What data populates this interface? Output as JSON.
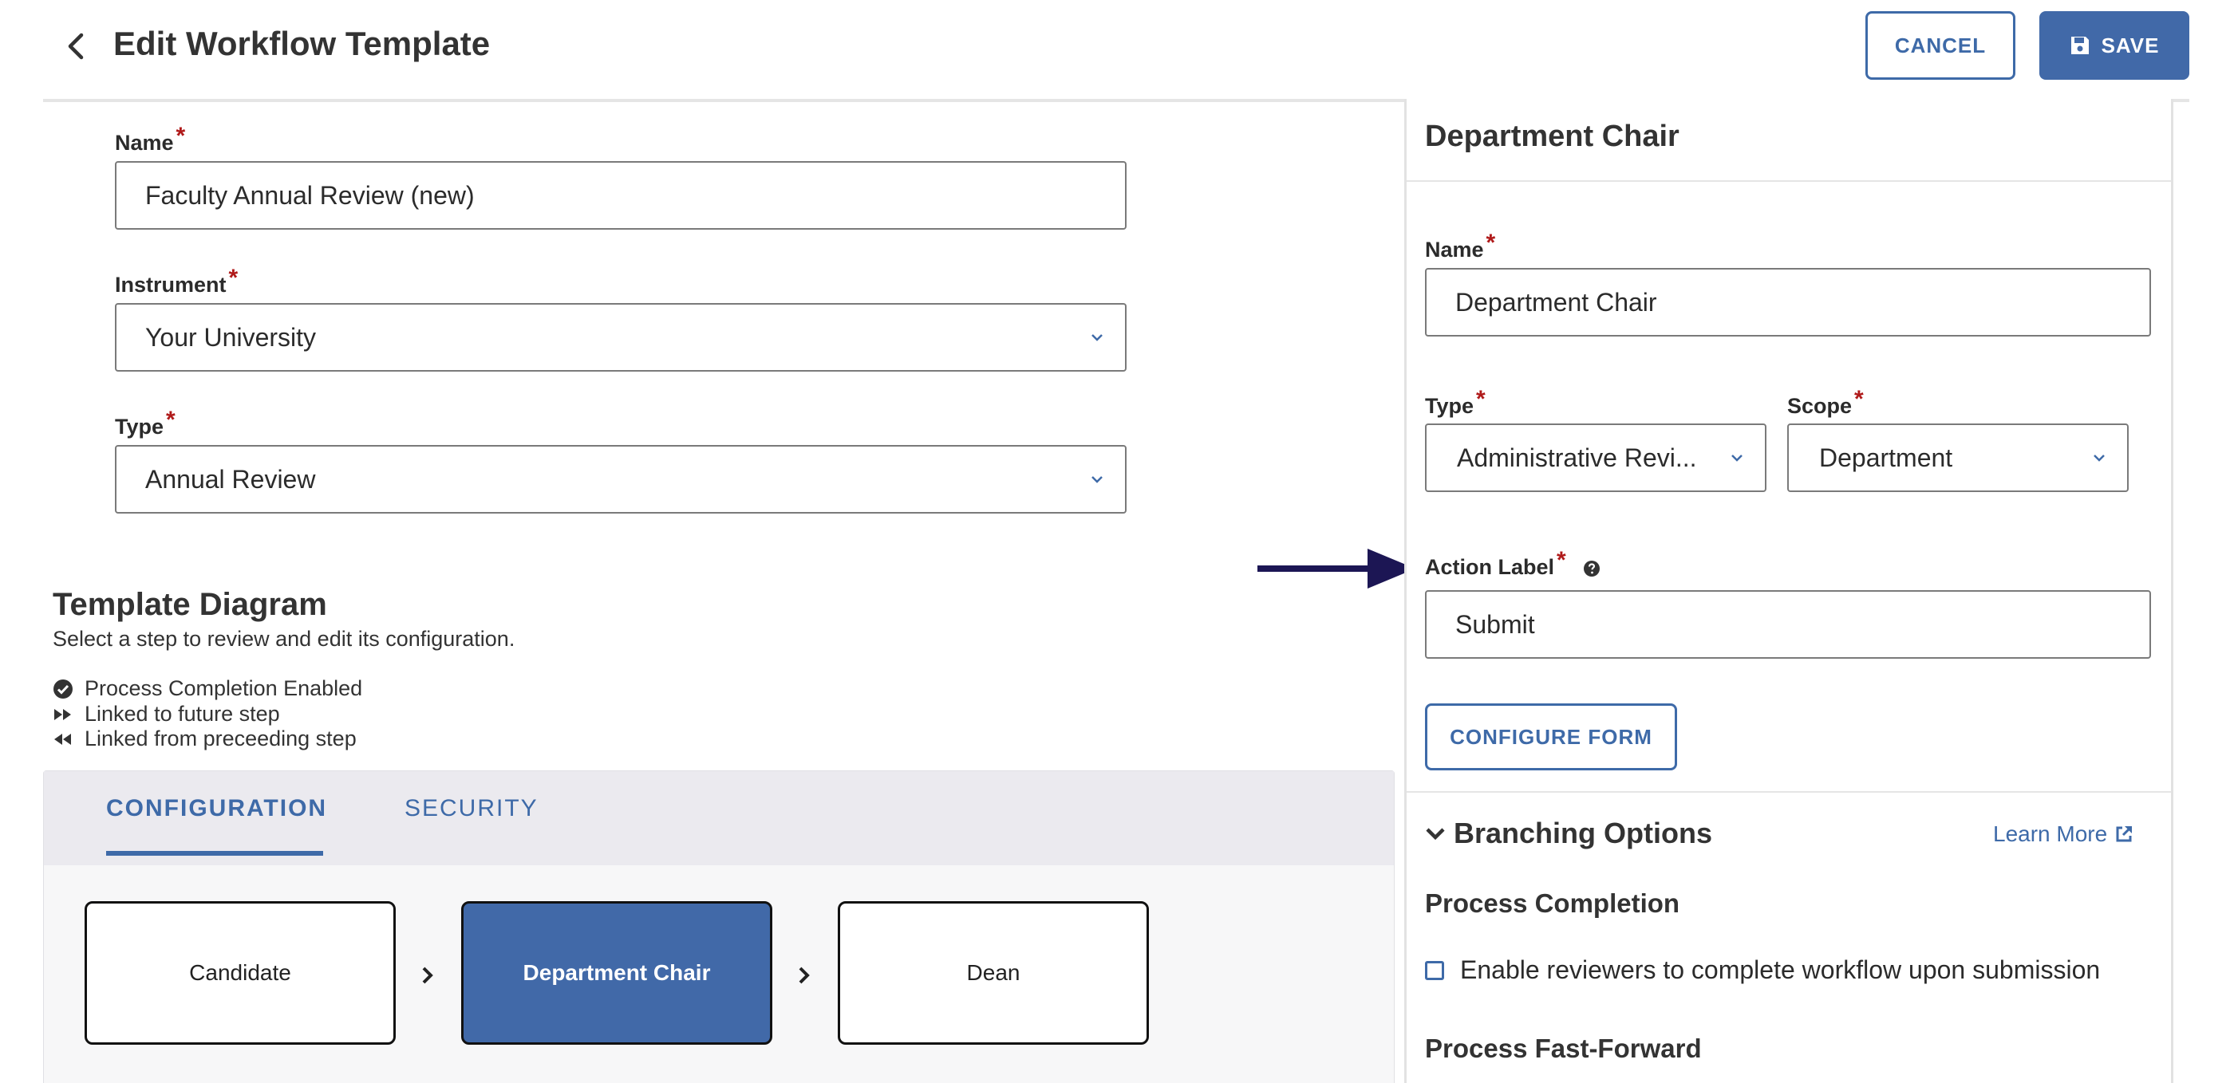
{
  "header": {
    "title": "Edit Workflow Template",
    "cancel_label": "CANCEL",
    "save_label": "SAVE"
  },
  "template_form": {
    "name": {
      "label": "Name",
      "required_mark": "*",
      "value": "Faculty Annual Review (new)"
    },
    "instrument": {
      "label": "Instrument",
      "required_mark": "*",
      "value": "Your University"
    },
    "type": {
      "label": "Type",
      "required_mark": "*",
      "value": "Annual Review"
    }
  },
  "template_diagram": {
    "title": "Template Diagram",
    "subtitle": "Select a step to review and edit its configuration.",
    "legend": [
      {
        "icon": "check-circle-icon",
        "label": "Process Completion Enabled"
      },
      {
        "icon": "fast-forward-icon",
        "label": "Linked to future step"
      },
      {
        "icon": "rewind-icon",
        "label": "Linked from preceeding step"
      }
    ],
    "tabs": [
      {
        "label": "CONFIGURATION",
        "active": true
      },
      {
        "label": "SECURITY",
        "active": false
      }
    ],
    "steps": [
      {
        "label": "Candidate",
        "selected": false
      },
      {
        "label": "Department Chair",
        "selected": true
      },
      {
        "label": "Dean",
        "selected": false
      }
    ]
  },
  "step_panel": {
    "title": "Department Chair",
    "name": {
      "label": "Name",
      "required_mark": "*",
      "value": "Department Chair"
    },
    "type": {
      "label": "Type",
      "required_mark": "*",
      "value": "Administrative Revi..."
    },
    "scope": {
      "label": "Scope",
      "required_mark": "*",
      "value": "Department"
    },
    "action_label": {
      "label": "Action Label",
      "required_mark": "*",
      "value": "Submit"
    },
    "configure_form_label": "CONFIGURE FORM",
    "branching": {
      "title": "Branching Options",
      "learn_more": "Learn More",
      "process_completion_title": "Process Completion",
      "process_completion_checkbox": "Enable reviewers to complete workflow upon submission",
      "process_completion_checked": false,
      "fast_forward_title": "Process Fast-Forward"
    }
  },
  "colors": {
    "accent": "#4169a8",
    "required": "#b01a1a",
    "annotation_arrow": "#1c1654"
  }
}
